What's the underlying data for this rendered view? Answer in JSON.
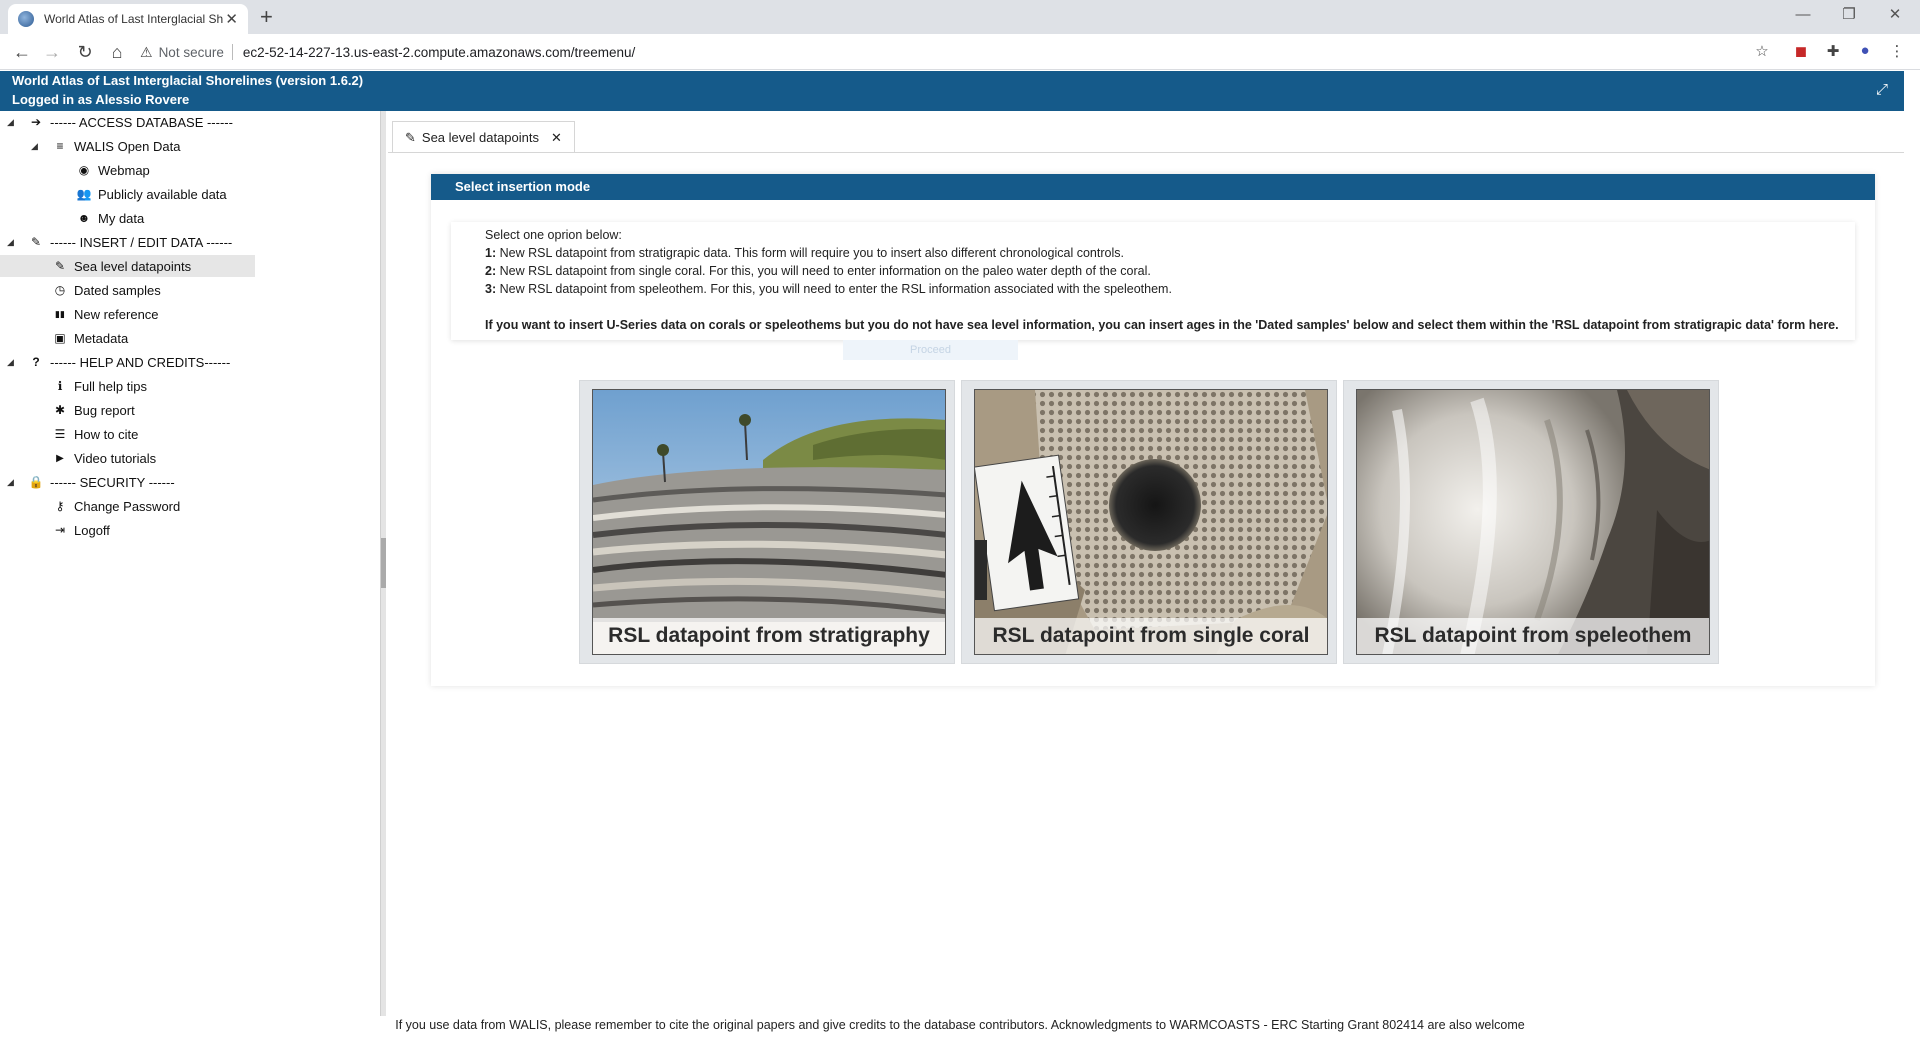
{
  "browser": {
    "tab_title": "World Atlas of Last Interglacial Sh",
    "tab_close": "✕",
    "new_tab": "+",
    "window_controls": [
      "—",
      "❐",
      "✕"
    ],
    "back": "←",
    "forward": "→",
    "reload": "↻",
    "home": "⌂",
    "security_icon": "⚠",
    "security_label": "Not secure",
    "url": "ec2-52-14-227-13.us-east-2.compute.amazonaws.com/treemenu/",
    "toolbar_icons": [
      "☆",
      "◼",
      "✚",
      "●",
      "⋮"
    ]
  },
  "app": {
    "title": "World Atlas of Last Interglacial Shorelines (version 1.6.2)",
    "user": "Logged in as Alessio Rovere",
    "fullscreen_icon": "⤢"
  },
  "sidebar": {
    "toggle": "◢",
    "sections": [
      {
        "label": "------ ACCESS DATABASE ------",
        "icon": "➔"
      },
      {
        "label": "WALIS Open Data",
        "icon": "≡"
      },
      {
        "label": "------ INSERT / EDIT DATA ------",
        "icon": "✎"
      },
      {
        "label": "------ HELP AND CREDITS------",
        "icon": "?"
      },
      {
        "label": "------ SECURITY ------",
        "icon": "🔒"
      }
    ],
    "items": [
      {
        "label": "Webmap",
        "icon": "◉"
      },
      {
        "label": "Publicly available data",
        "icon": "👥"
      },
      {
        "label": "My data",
        "icon": "☻"
      },
      {
        "label": "Sea level datapoints",
        "icon": "✎"
      },
      {
        "label": "Dated samples",
        "icon": "◷"
      },
      {
        "label": "New reference",
        "icon": "▮▮"
      },
      {
        "label": "Metadata",
        "icon": "▣"
      },
      {
        "label": "Full help tips",
        "icon": "ℹ"
      },
      {
        "label": "Bug report",
        "icon": "✱"
      },
      {
        "label": "How to cite",
        "icon": "☰"
      },
      {
        "label": "Video tutorials",
        "icon": "▶"
      },
      {
        "label": "Change Password",
        "icon": "⚷"
      },
      {
        "label": "Logoff",
        "icon": "⇥"
      }
    ]
  },
  "content_tab": {
    "label": "Sea level datapoints",
    "icon": "✎",
    "close": "✕"
  },
  "panel": {
    "title": "Select insertion mode",
    "intro": "Select one oprion below:",
    "options": [
      {
        "num": "1:",
        "text": " New RSL datapoint from stratigrapic data. This form will require you to insert also different chronological controls."
      },
      {
        "num": "2:",
        "text": " New RSL datapoint from single coral. For this, you will need to enter information on the paleo water depth of the coral."
      },
      {
        "num": "3:",
        "text": " New RSL datapoint from speleothem. For this, you will need to enter the RSL information associated with the speleothem."
      }
    ],
    "note": "If you want to insert U-Series data on corals or speleothems but you do not have sea level information, you can insert ages in the 'Dated samples' below and select them within the 'RSL datapoint from stratigrapic data' form here.",
    "ghost_button": "Proceed"
  },
  "cards": [
    {
      "label": "RSL datapoint from stratigraphy"
    },
    {
      "label": "RSL datapoint from single coral"
    },
    {
      "label": "RSL datapoint from speleothem"
    }
  ],
  "footer": "If you use data from WALIS, please remember to cite the original papers and give credits to the database contributors. Acknowledgments to WARMCOASTS - ERC Starting Grant 802414 are also welcome"
}
